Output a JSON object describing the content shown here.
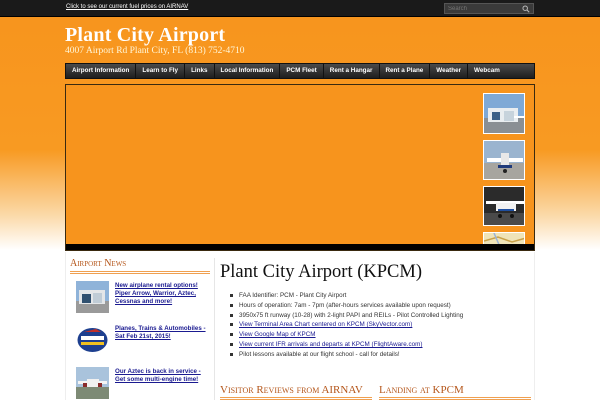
{
  "topbar": {
    "fuel_link": "Click to see our current fuel prices on AIRNAV",
    "search_placeholder": "Search"
  },
  "header": {
    "title": "Plant City Airport",
    "description": "4007 Airport Rd Plant City, FL (813) 752-4710"
  },
  "nav": {
    "items": [
      "Airport Information",
      "Learn to Fly",
      "Links",
      "Local Information",
      "PCM Fleet",
      "Rent a Hangar",
      "Rent a Plane",
      "Weather",
      "Webcam"
    ]
  },
  "sidebar": {
    "heading": "Airport News",
    "news": [
      {
        "title": "New airplane rental options! Piper Arrow, Warrior, Aztec, Cessnas and more!",
        "icon": "hangar-photo"
      },
      {
        "title": "Planes, Trains & Automobiles - Sat Feb 21st, 2015!",
        "icon": "event-logo"
      },
      {
        "title": "Our Aztec is back in service - Get some multi-engine time!",
        "icon": "aztec-photo"
      }
    ]
  },
  "main": {
    "page_title": "Plant City Airport (KPCM)",
    "facts": [
      {
        "text": "FAA Identifier: PCM - Plant City Airport",
        "link": false
      },
      {
        "text": "Hours of operation: 7am - 7pm (after-hours services available upon request)",
        "link": false
      },
      {
        "text": "3950x75 ft runway (10-28) with 2-light PAPI and REILs - Pilot Controlled Lighting",
        "link": false
      },
      {
        "text": "View Terminal Area Chart centered on KPCM (SkyVector.com)",
        "link": true
      },
      {
        "text": "View Google Map of KPCM",
        "link": true
      },
      {
        "text": "View current IFR arrivals and departs at KPCM (FlightAware.com)",
        "link": true
      },
      {
        "text": "Pilot lessons available at our flight school - call for details!",
        "link": false
      }
    ],
    "reviews_heading": "Visitor Reviews from AIRNAV",
    "landing_heading": "Landing at KPCM"
  },
  "colors": {
    "accent_orange": "#f7941d",
    "heading_orange": "#b5561a",
    "link_blue": "#1a1a90"
  }
}
